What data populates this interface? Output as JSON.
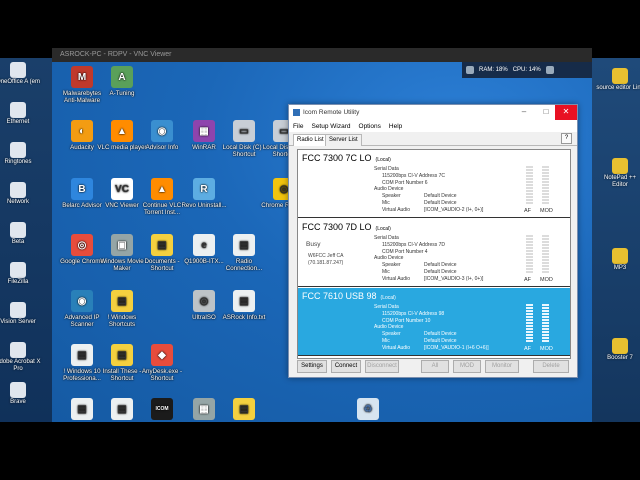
{
  "host_left_icons": [
    "OneOffice A (em",
    "Ethernet",
    "Ringtones",
    "Network",
    "Beta",
    "FileZilla",
    "Vision Server",
    "Adobe Acrobat X Pro",
    "Brave"
  ],
  "host_right_icons": [
    "source editor Link",
    "NotePad ++ Editor",
    "MP3",
    "Booster 7"
  ],
  "vnc_title": "ASROCK-PC - RDPV - VNC Viewer",
  "tray": {
    "ram": "RAM: 18%",
    "cpu": "CPU: 14%"
  },
  "desktop_icons": [
    {
      "label": "Malwarebytes Anti-Malware",
      "color": "#c0392b",
      "glyph": "M"
    },
    {
      "label": "A-Tuning",
      "color": "#5aa05a",
      "glyph": "A"
    },
    {
      "label": "Audacity",
      "color": "#f39c12",
      "glyph": "◐"
    },
    {
      "label": "VLC media player",
      "color": "#ff8c00",
      "glyph": "▲"
    },
    {
      "label": "Advisor Info",
      "color": "#3a8fd0",
      "glyph": "◉"
    },
    {
      "label": "WinRAR",
      "color": "#8e44ad",
      "glyph": "▦"
    },
    {
      "label": "Local Disk (C) - Shortcut",
      "color": "#c8ced6",
      "glyph": "▭"
    },
    {
      "label": "Local Disk (E) - Shortcut",
      "color": "#c8ced6",
      "glyph": "▭"
    },
    {
      "label": "Belarc Advisor",
      "color": "#2e86de",
      "glyph": "B"
    },
    {
      "label": "VNC Viewer",
      "color": "#ffffff",
      "glyph": "VC"
    },
    {
      "label": "Continue VLC Torrent Inst...",
      "color": "#ff8c00",
      "glyph": "▲"
    },
    {
      "label": "Revo Uninstall...",
      "color": "#5dade2",
      "glyph": "R"
    },
    {
      "label": "Chrome Remo...",
      "color": "#f1c40f",
      "glyph": "◎"
    },
    {
      "label": "Google Chrome",
      "color": "#e74c3c",
      "glyph": "◎"
    },
    {
      "label": "Windows Movie Maker",
      "color": "#95a5a6",
      "glyph": "▣"
    },
    {
      "label": "Documents - Shortcut",
      "color": "#f4d03f",
      "glyph": "▤"
    },
    {
      "label": "Q1900B-ITX...",
      "color": "#ecf0f1",
      "glyph": "e"
    },
    {
      "label": "Radio Connection...",
      "color": "#ecf0f1",
      "glyph": "▤"
    },
    {
      "label": "Advanced IP Scanner",
      "color": "#2980b9",
      "glyph": "◉"
    },
    {
      "label": "! Windows Shortcuts",
      "color": "#f4d03f",
      "glyph": "▤"
    },
    {
      "label": "UltraISO",
      "color": "#bdc3c7",
      "glyph": "◎"
    },
    {
      "label": "ASRock Info.txt",
      "color": "#ecf0f1",
      "glyph": "▤"
    },
    {
      "label": "! Windows 10 Professiona...",
      "color": "#ecf0f1",
      "glyph": "▤"
    },
    {
      "label": "Install These - Shortcut",
      "color": "#f4d03f",
      "glyph": "▤"
    },
    {
      "label": "AnyDesk.exe - Shortcut",
      "color": "#e74c3c",
      "glyph": "◆"
    },
    {
      "label": "",
      "color": "#ecf0f1",
      "glyph": "▤"
    },
    {
      "label": "",
      "color": "#ecf0f1",
      "glyph": "▤"
    },
    {
      "label": "",
      "color": "#1b1b1b",
      "glyph": "ICOM"
    },
    {
      "label": "",
      "color": "#95a5a6",
      "glyph": "▦"
    },
    {
      "label": "",
      "color": "#f4d03f",
      "glyph": "▤"
    }
  ],
  "icom": {
    "title": "Icom Remote Utility",
    "menu": [
      "File",
      "Setup Wizard",
      "Options",
      "Help"
    ],
    "tabs": [
      "Radio List",
      "Server List"
    ],
    "help": "?",
    "radios": [
      {
        "name": "FCC 7300 7C LO",
        "tag": "(Local)",
        "status": "",
        "sub": "",
        "lines": [
          "Serial Data",
          "115200bps  CI-V Address 7C",
          "COM Port Number 6",
          "Audio Device",
          "Speaker",
          "Mic",
          "Virtual Audio"
        ],
        "lines2": [
          "",
          "",
          "",
          "",
          "Default Device",
          "Default Device",
          "[ICOM_VAUDIO-2 (I+, 0+)]"
        ],
        "af": "AF",
        "mod": "MOD",
        "selected": false
      },
      {
        "name": "FCC 7300 7D LO",
        "tag": "(Local)",
        "status": "Busy",
        "sub": "W6FCC Jeff CA (70.181.87.247)",
        "lines": [
          "Serial Data",
          "115200bps  CI-V Address 7D",
          "COM Port Number 4",
          "Audio Device",
          "Speaker",
          "Mic",
          "Virtual Audio"
        ],
        "lines2": [
          "",
          "",
          "",
          "",
          "Default Device",
          "Default Device",
          "[ICOM_VAUDIO-3 (I+, 0+)]"
        ],
        "af": "AF",
        "mod": "MOD",
        "selected": false
      },
      {
        "name": "FCC 7610 USB 98",
        "tag": "(Local)",
        "status": "",
        "sub": "",
        "lines": [
          "Serial Data",
          "115200bps  CI-V Address 98",
          "COM Port Number 10",
          "Audio Device",
          "Speaker",
          "Mic",
          "Virtual Audio"
        ],
        "lines2": [
          "",
          "",
          "",
          "",
          "Default Device",
          "Default Device",
          "[ICOM_VAUDIO-1 (I+6 O+6)]"
        ],
        "af": "AF",
        "mod": "MOD",
        "selected": true
      }
    ],
    "buttons": {
      "settings": "Settings",
      "connect": "Connect",
      "disconnect": "Disconnect",
      "all": "All",
      "mod": "MOD",
      "monitor": "Monitor",
      "delete": "Delete"
    }
  }
}
